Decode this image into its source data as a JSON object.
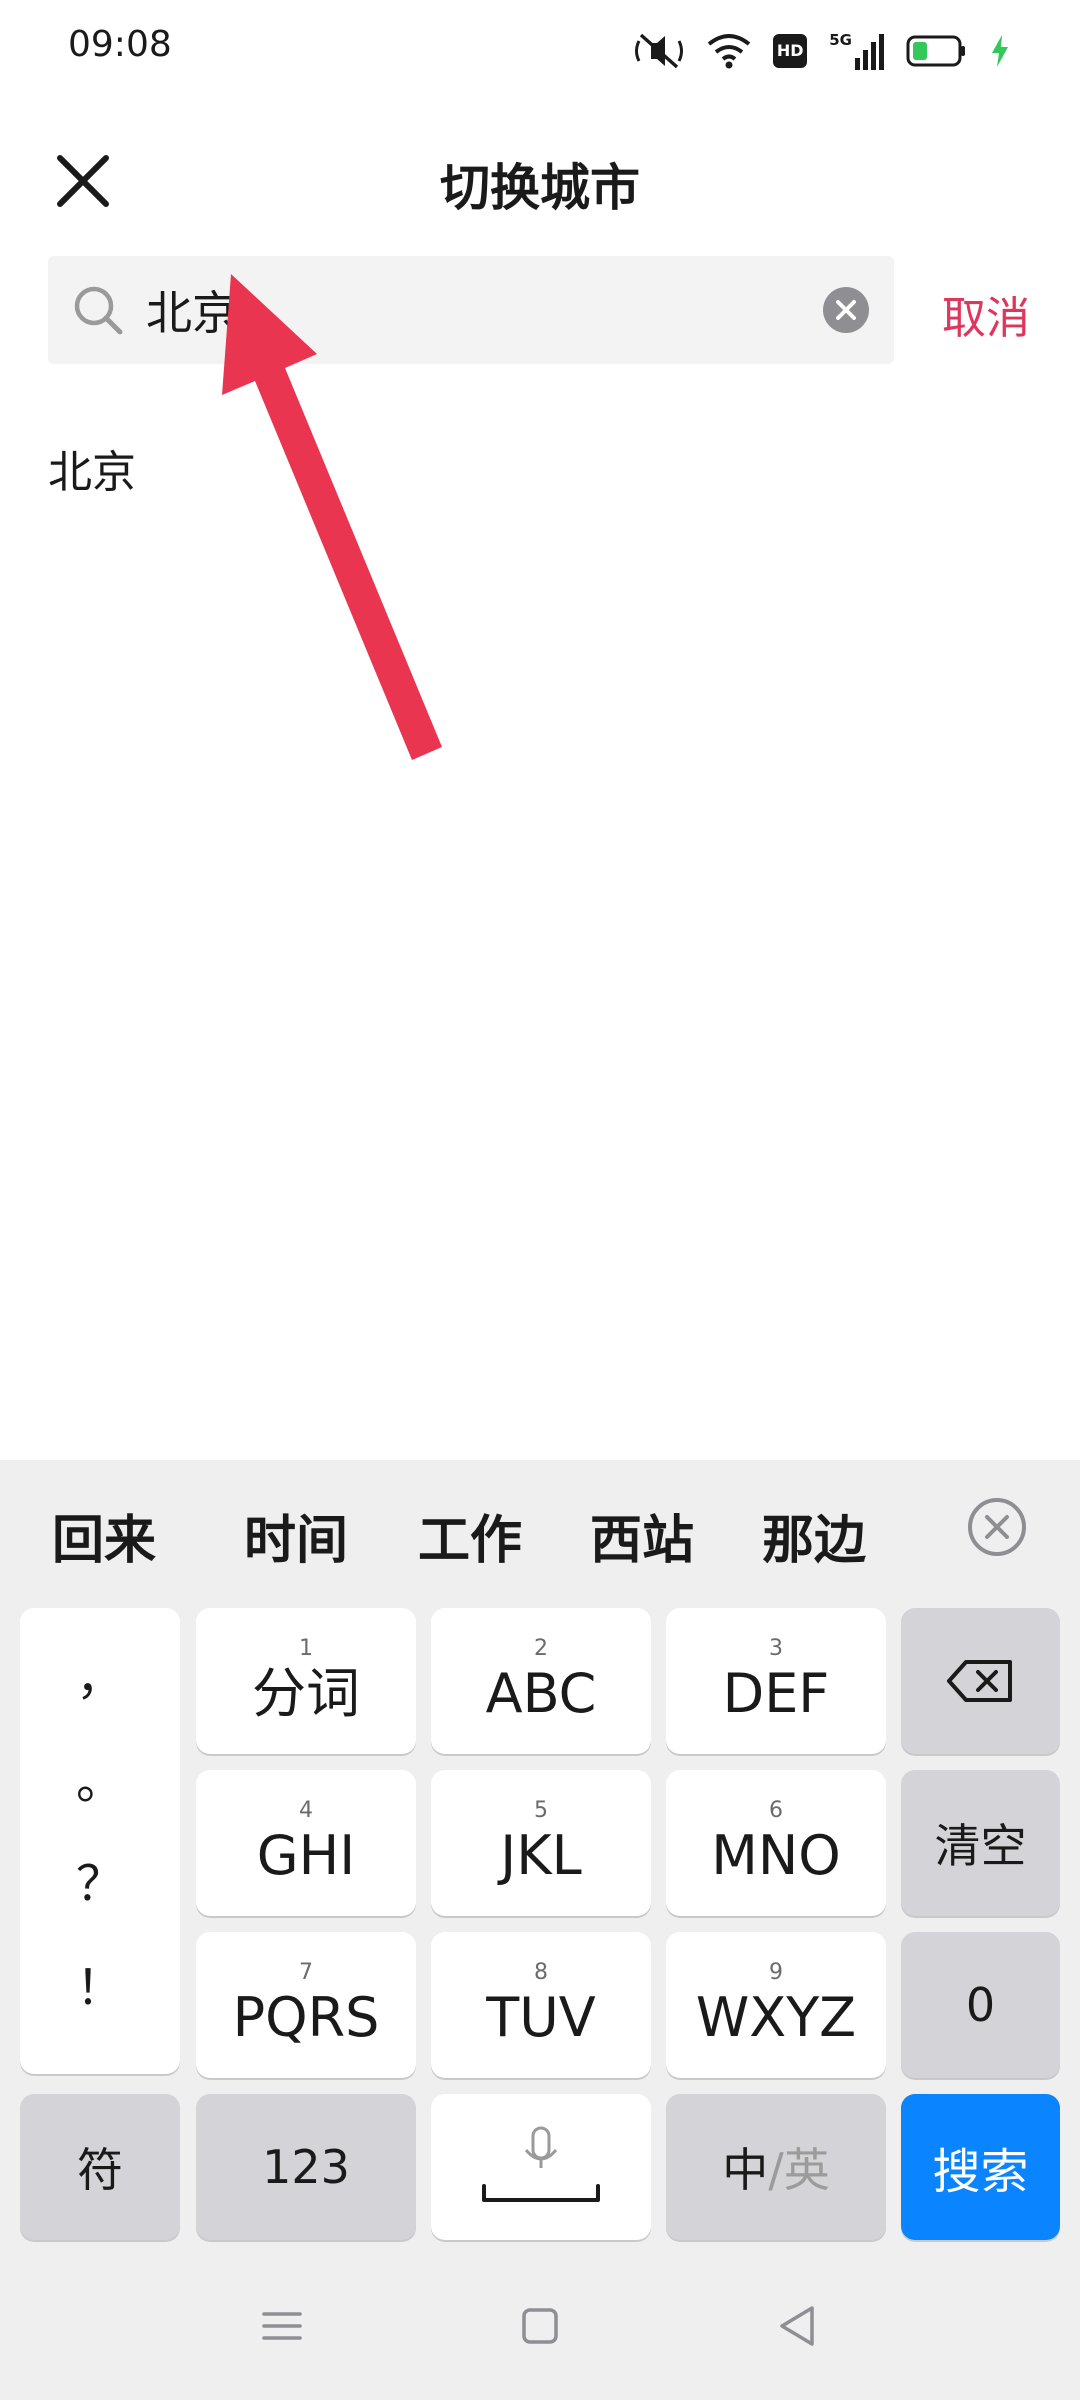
{
  "status_bar": {
    "time": "09:08",
    "icons": [
      "mute-icon",
      "wifi-icon",
      "hd-icon",
      "signal-5g-icon",
      "battery-icon",
      "charging-icon"
    ],
    "hd_label": "HD",
    "network_label": "5G",
    "battery_color": "#34c759"
  },
  "header": {
    "title": "切换城市"
  },
  "search": {
    "value": "北京",
    "cancel_label": "取消"
  },
  "results": [
    {
      "label": "北京"
    }
  ],
  "annotation": {
    "arrow_color": "#ea3550"
  },
  "keyboard": {
    "candidates": [
      "回来",
      "时间",
      "工作",
      "西站",
      "那边"
    ],
    "punctuation": [
      "，",
      "。",
      "？",
      "！"
    ],
    "keys": [
      {
        "num": "1",
        "label": "分词"
      },
      {
        "num": "2",
        "label": "ABC"
      },
      {
        "num": "3",
        "label": "DEF"
      },
      {
        "num": "4",
        "label": "GHI"
      },
      {
        "num": "5",
        "label": "JKL"
      },
      {
        "num": "6",
        "label": "MNO"
      },
      {
        "num": "7",
        "label": "PQRS"
      },
      {
        "num": "8",
        "label": "TUV"
      },
      {
        "num": "9",
        "label": "WXYZ"
      }
    ],
    "clear_label": "清空",
    "zero_label": "0",
    "symbol_label": "符",
    "numeric_label": "123",
    "lang_primary": "中",
    "lang_secondary": "/英",
    "search_label": "搜索",
    "accent_color": "#0a84ff"
  },
  "navbar": {
    "icons": [
      "menu-icon",
      "home-icon",
      "back-icon"
    ]
  }
}
